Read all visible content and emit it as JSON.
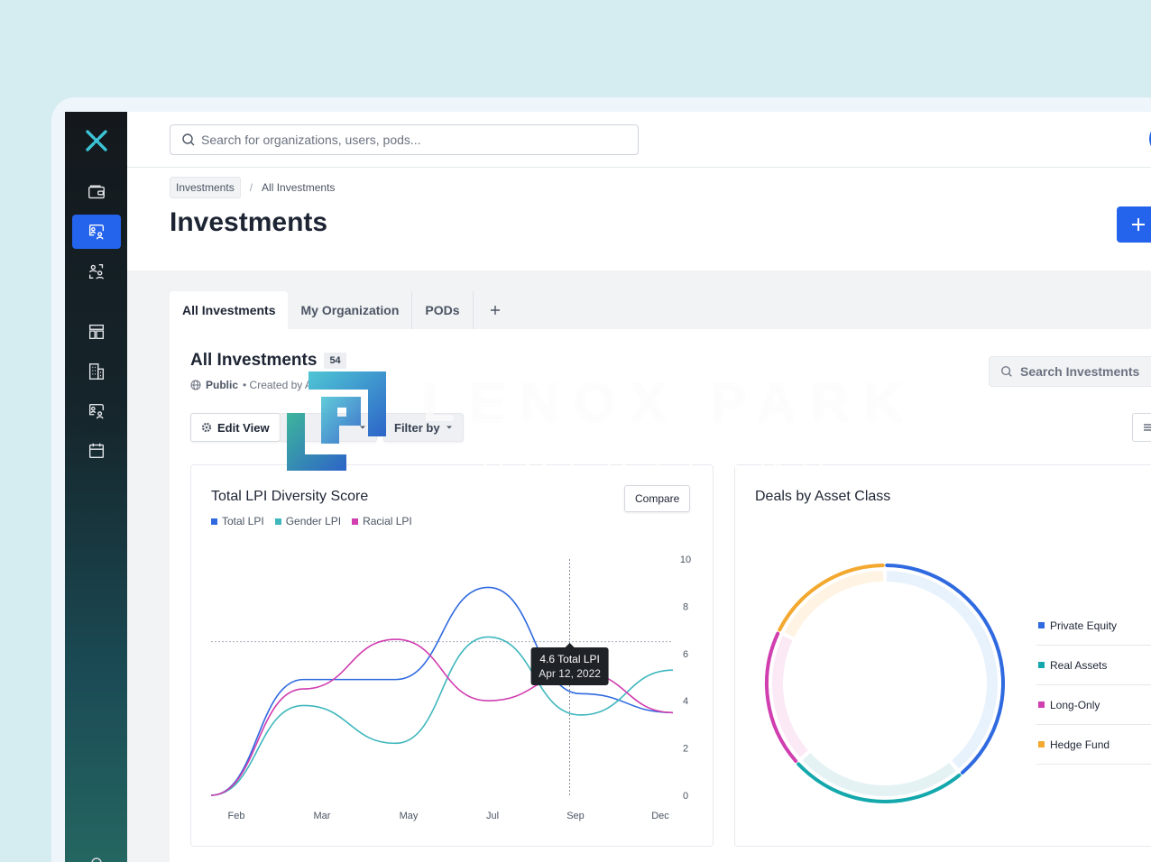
{
  "topbar": {
    "search_placeholder": "Search for organizations, users, pods..."
  },
  "breadcrumb": {
    "root": "Investments",
    "current": "All Investments"
  },
  "page": {
    "title": "Investments"
  },
  "tabs": [
    {
      "label": "All Investments",
      "active": true
    },
    {
      "label": "My Organization",
      "active": false
    },
    {
      "label": "PODs",
      "active": false
    }
  ],
  "panel": {
    "title": "All Investments",
    "count": "54",
    "visibility": "Public",
    "created_by": "• Created by Ava W",
    "search_label": "Search Investments",
    "buttons": {
      "edit_view": "Edit View",
      "second_btn": "T",
      "filter_by": "Filter by"
    }
  },
  "lpi_chart": {
    "title": "Total LPI Diversity Score",
    "compare_label": "Compare",
    "tooltip": {
      "value": "4.6 Total LPI",
      "date": "Apr 12, 2022"
    }
  },
  "deals_chart": {
    "title": "Deals by Asset Class"
  },
  "watermark": {
    "line1": "LENOX PARK",
    "line2": "SOLUTIONS"
  },
  "colors": {
    "primary": "#2463eb",
    "total_lpi": "#2f6ae0",
    "gender_lpi": "#3fb7bd",
    "racial_lpi": "#d03eb0",
    "private_equity": "#2f6ae0",
    "real_assets": "#14a8ad",
    "long_only": "#d03eb0",
    "hedge_fund": "#f3a830"
  },
  "chart_data": [
    {
      "type": "line",
      "title": "Total LPI Diversity Score",
      "x": [
        "Feb",
        "Mar",
        "May",
        "Jul",
        "Sep",
        "Dec"
      ],
      "xticks": [
        "Feb",
        "Mar",
        "May",
        "Jul",
        "Sep",
        "Dec"
      ],
      "ylim": [
        0,
        10
      ],
      "yticks": [
        0,
        2,
        4,
        6,
        8,
        10
      ],
      "grid": false,
      "legend": "top-left",
      "series": [
        {
          "name": "Total LPI",
          "color": "#2f6ae0",
          "values": [
            0,
            4.9,
            4.9,
            8.8,
            4.3,
            3.5
          ]
        },
        {
          "name": "Gender LPI",
          "color": "#3fb7bd",
          "values": [
            0,
            3.8,
            2.2,
            6.7,
            3.4,
            5.3
          ]
        },
        {
          "name": "Racial LPI",
          "color": "#d03eb0",
          "values": [
            0,
            4.5,
            6.6,
            4.0,
            5.2,
            3.5
          ]
        }
      ],
      "reference_line": 6.5,
      "tooltip": {
        "x_index": 4,
        "label": "4.6 Total LPI",
        "date": "Apr 12, 2022"
      }
    },
    {
      "type": "pie",
      "title": "Deals by Asset Class",
      "categories": [
        "Private Equity",
        "Real Assets",
        "Long-Only",
        "Hedge Fund"
      ],
      "values": [
        35,
        22,
        17,
        16
      ],
      "colors": [
        "#2f6ae0",
        "#14a8ad",
        "#d03eb0",
        "#f3a830"
      ],
      "legend": "right"
    }
  ]
}
